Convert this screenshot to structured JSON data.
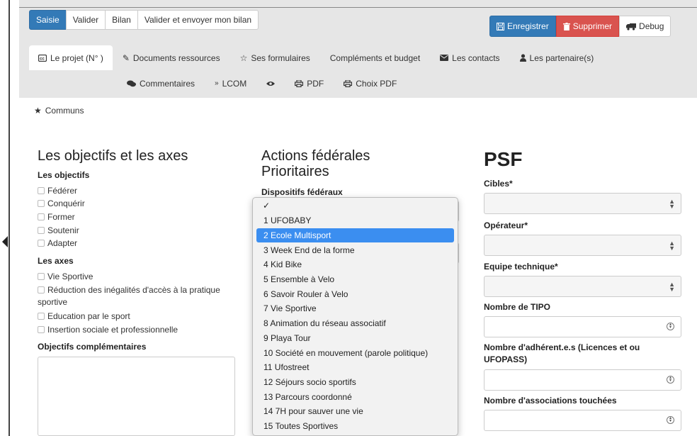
{
  "toolbar": {
    "buttons": [
      "Saisie",
      "Valider",
      "Bilan",
      "Valider et envoyer mon bilan"
    ],
    "save_label": "Enregistrer",
    "delete_label": "Supprimer",
    "debug_label": "Debug"
  },
  "tabs": {
    "row1": [
      "Le projet (N° )",
      "Documents ressources",
      "Ses formulaires",
      "Compléments et budget",
      "Les contacts",
      "Les partenaire(s)"
    ],
    "row2": [
      "Commentaires",
      "LCOM",
      "",
      "PDF",
      "Choix PDF"
    ]
  },
  "section": {
    "communs": "Communs"
  },
  "col1": {
    "title": "Les objectifs et les axes",
    "objectifs_label": "Les objectifs",
    "objectifs": [
      "Fédérer",
      "Conquérir",
      "Former",
      "Soutenir",
      "Adapter"
    ],
    "axes_label": "Les axes",
    "axes": [
      "Vie Sportive",
      "Réduction des inégalités d'accès à la pratique",
      "sportive",
      "Education par le sport",
      "Insertion sociale et professionnelle"
    ],
    "complementaires_label": "Objectifs complémentaires"
  },
  "col2": {
    "title_line1": "Actions fédérales",
    "title_line2": "Prioritaires",
    "dispositifs_label": "Dispositifs fédéraux",
    "dropdown_check": "✓",
    "dropdown_items": [
      "1 UFOBABY",
      "2 Ecole Multisport",
      "3 Week End de la forme",
      "4 Kid Bike",
      "5 Ensemble à Velo",
      "6 Savoir Rouler à Velo",
      "7 Vie Sportive",
      "8 Animation du réseau associatif",
      "9 Playa Tour",
      "10 Société en mouvement (parole politique)",
      "11 Ufostreet",
      "12 Séjours socio sportifs",
      "13 Parcours coordonné",
      "14 7H pour sauver une vie",
      "15 Toutes Sportives"
    ],
    "selected_index": 1
  },
  "col3": {
    "title": "PSF",
    "cibles": "Cibles*",
    "operateur": "Opérateur*",
    "equipe": "Equipe technique*",
    "tipo": "Nombre de TIPO",
    "adherents_line1": "Nombre d'adhérent.e.s (Licences et ou",
    "adherents_line2": "UFOPASS)",
    "associations": "Nombre d'associations touchées"
  },
  "colors": {
    "primary": "#337ab7",
    "danger": "#d9534f",
    "selected": "#3b8ef0"
  },
  "icons": {
    "save": "floppy-icon",
    "delete": "trash-icon",
    "debug": "truck-icon",
    "projet": "cc-icon",
    "documents": "paperclip-icon",
    "formulaires": "star-outline-icon",
    "contacts": "envelope-icon",
    "partenaires": "user-icon",
    "commentaires": "comments-icon",
    "lcom": "double-chevron-icon",
    "view": "eye-icon",
    "pdf": "print-icon",
    "communs": "star-icon"
  }
}
